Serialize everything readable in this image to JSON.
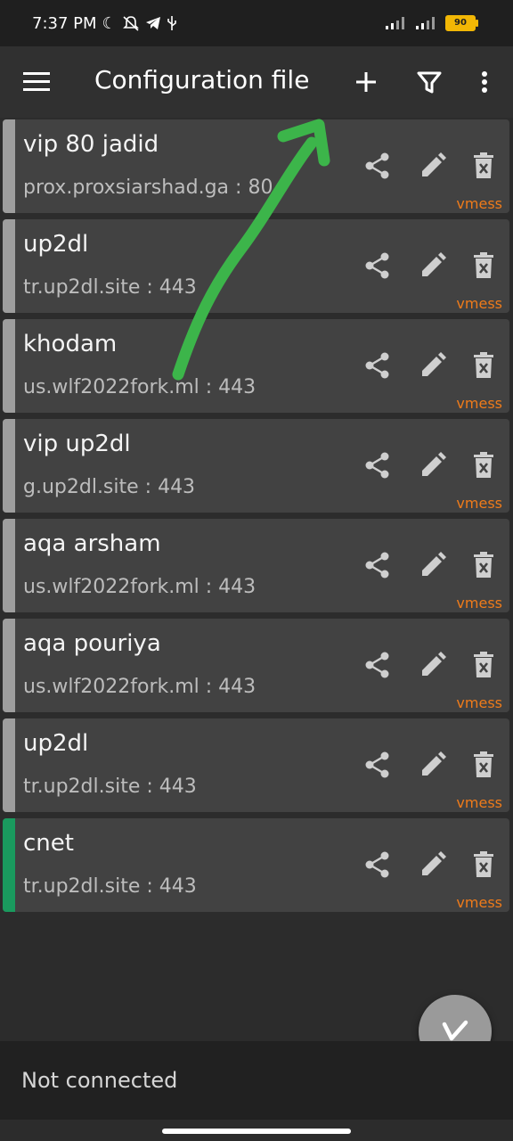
{
  "status_bar": {
    "time": "7:37 PM",
    "battery": "90"
  },
  "app_bar": {
    "title": "Configuration file",
    "menu_icon": "hamburger-menu-icon",
    "add_icon": "plus-icon",
    "filter_icon": "filter-icon",
    "more_icon": "more-vert-icon"
  },
  "servers": [
    {
      "name": "vip 80 jadid",
      "address": "prox.proxsiarshad.ga : 80",
      "type": "vmess",
      "active": false
    },
    {
      "name": "up2dl",
      "address": "tr.up2dl.site : 443",
      "type": "vmess",
      "active": false
    },
    {
      "name": "khodam",
      "address": "us.wlf2022fork.ml : 443",
      "type": "vmess",
      "active": false
    },
    {
      "name": "vip up2dl",
      "address": "g.up2dl.site : 443",
      "type": "vmess",
      "active": false
    },
    {
      "name": "aqa arsham",
      "address": "us.wlf2022fork.ml : 443",
      "type": "vmess",
      "active": false
    },
    {
      "name": "aqa pouriya",
      "address": "us.wlf2022fork.ml : 443",
      "type": "vmess",
      "active": false
    },
    {
      "name": "up2dl",
      "address": "tr.up2dl.site : 443",
      "type": "vmess",
      "active": false
    },
    {
      "name": "cnet",
      "address": "tr.up2dl.site : 443",
      "type": "vmess",
      "active": true
    }
  ],
  "colors": {
    "active_indicator": "#1a9a5e",
    "inactive_indicator": "#9e9e9e",
    "type_label": "#ef7b1a",
    "annotation_arrow": "#3cb54a"
  },
  "connection_status": "Not connected"
}
